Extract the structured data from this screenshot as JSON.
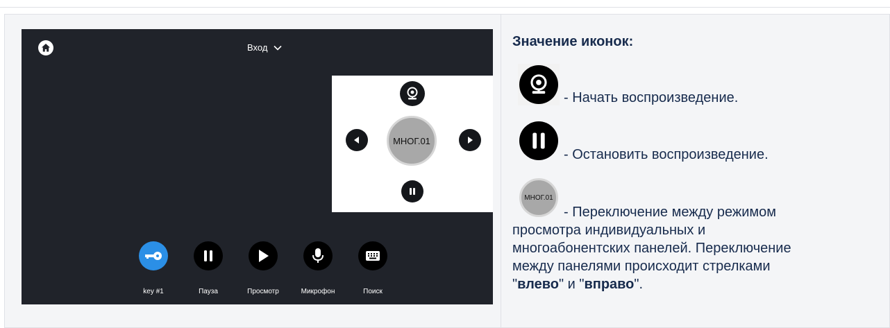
{
  "device": {
    "entry_select": "Вход",
    "center_button": "МНОГ.01",
    "bottom_bar": [
      {
        "label": "key #1",
        "icon": "key-icon",
        "color": "#2b8fe6"
      },
      {
        "label": "Пауза",
        "icon": "pause-icon",
        "color": "#000000"
      },
      {
        "label": "Просмотр",
        "icon": "play-icon",
        "color": "#000000"
      },
      {
        "label": "Микрофон",
        "icon": "microphone-icon",
        "color": "#000000"
      },
      {
        "label": "Поиск",
        "icon": "keyboard-icon",
        "color": "#000000"
      }
    ]
  },
  "legend": {
    "title": "Значение иконок:",
    "play_desc": "- Начать воспроизведение.",
    "stop_desc": "- Остановить воспроизведение.",
    "mode_icon_label": "МНОГ.01",
    "mode_desc": "- Переключение между режимом",
    "para_line1": "просмотра индивидуальных и",
    "para_line2": "многоабонентских панелей. Переключение",
    "para_line3": "между панелями происходит стрелками",
    "q1": "\"",
    "left_word": "влево",
    "mid": "\" и \"",
    "right_word": "вправо",
    "end": "\"."
  }
}
